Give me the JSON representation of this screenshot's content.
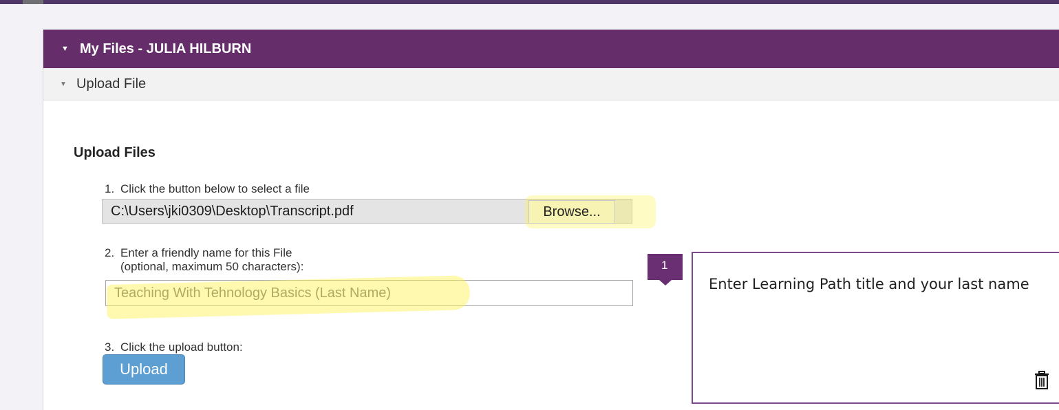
{
  "panel": {
    "title": "My Files - JULIA HILBURN",
    "section_label": "Upload File"
  },
  "upload": {
    "heading": "Upload Files",
    "step1": {
      "number": "1.",
      "text": "Click the button below to select a file",
      "file_path": "C:\\Users\\jki0309\\Desktop\\Transcript.pdf",
      "browse_label": "Browse..."
    },
    "step2": {
      "number": "2.",
      "text": "Enter a friendly name for this File",
      "subtext": "(optional, maximum 50 characters):",
      "value": "Teaching With Tehnology Basics (Last Name)"
    },
    "step3": {
      "number": "3.",
      "text": "Click the upload button:",
      "upload_label": "Upload"
    }
  },
  "callout": {
    "number": "1",
    "text": "Enter Learning Path title and your last name",
    "delete_icon": "trash-icon"
  },
  "colors": {
    "header_purple": "#662d6b",
    "top_bar": "#4e3767",
    "upload_blue": "#5d9fd3",
    "highlight_yellow": "#fff450",
    "callout_purple": "#6a2f73"
  }
}
